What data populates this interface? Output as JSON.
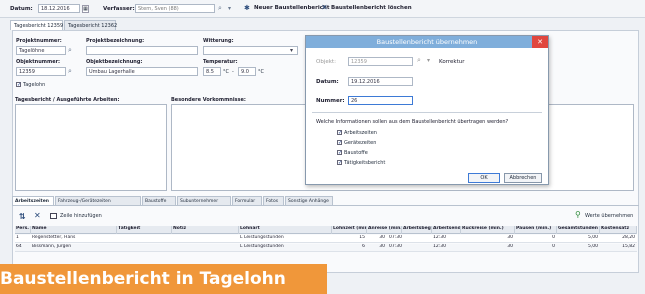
{
  "toolbar": {
    "date_label": "Datum:",
    "date_value": "18.12.2016",
    "author_label": "Verfasser:",
    "author_value": "Stern, Sven (88)",
    "new_report_label": "Neuer Baustellenbericht",
    "delete_report_label": "Baustellenbericht löschen"
  },
  "tabs": [
    "Tagesbericht 12359",
    "Tagesbericht 12362"
  ],
  "form": {
    "project_no_label": "Projektnummer:",
    "project_no_value": "Tagelöhne",
    "project_desc_label": "Projektbezeichnung:",
    "weather_label": "Witterung:",
    "object_no_label": "Objektnummer:",
    "object_no_value": "12359",
    "object_desc_label": "Objektbezeichnung:",
    "object_desc_value": "Umbau Lagerhalle",
    "temp_label": "Temperatur:",
    "temp_from": "8.5",
    "temp_to": "9.0",
    "temp_unit": "°C",
    "temp_sep": "-",
    "daywork_label": "Tagelohn",
    "report_section": "Tagesbericht / Ausgeführte Arbeiten:",
    "special_section": "Besondere Vorkommnisse:"
  },
  "dialog": {
    "title": "Baustellenbericht übernehmen",
    "object_label": "Objekt:",
    "object_value": "12359",
    "object_extra": "Korrektur",
    "date_label": "Datum:",
    "date_value": "19.12.2016",
    "number_label": "Nummer:",
    "number_value": "26",
    "question": "Welche Informationen sollen aus dem Baustellenbericht übertragen werden?",
    "options": [
      "Arbeitszeiten",
      "Gerätezeiten",
      "Baustoffe",
      "Tätigkeitsbericht"
    ],
    "ok_label": "OK",
    "cancel_label": "Abbrechen"
  },
  "bottom_tabs": [
    "Arbeitszeiten",
    "Fahrzeug-/Gerätezeiten",
    "Baustoffe",
    "Subunternehmer",
    "Formular",
    "Fotos",
    "Sonstige Anhänge"
  ],
  "grid_toolbar": {
    "add_label": "Zeile hinzufügen",
    "take_label": "Werte übernehmen"
  },
  "grid": {
    "columns": [
      "Pers. Nr.",
      "Name",
      "Tätigkeit",
      "Notiz",
      "Lohnart",
      "Lohnzeit (min.)",
      "Anreise (min.)",
      "Arbeitsbeginn",
      "Arbeitsende",
      "Rückreise (min.)",
      "Pausen (min.)",
      "Gesamtstunden",
      "Kostensatz"
    ],
    "rows": [
      [
        "1",
        "Regenstetter, Hans",
        "",
        "",
        "L Leistungsstunden",
        "15",
        "30",
        "07:30",
        "12:30",
        "30",
        "0",
        "5,00",
        "28,20"
      ],
      [
        "64",
        "Bissmann, Jürgen",
        "",
        "",
        "L Leistungsstunden",
        "6",
        "30",
        "07:30",
        "12:30",
        "30",
        "0",
        "5,00",
        "15,82"
      ]
    ]
  },
  "banner_text": "Baustellenbericht in Tagelohn"
}
